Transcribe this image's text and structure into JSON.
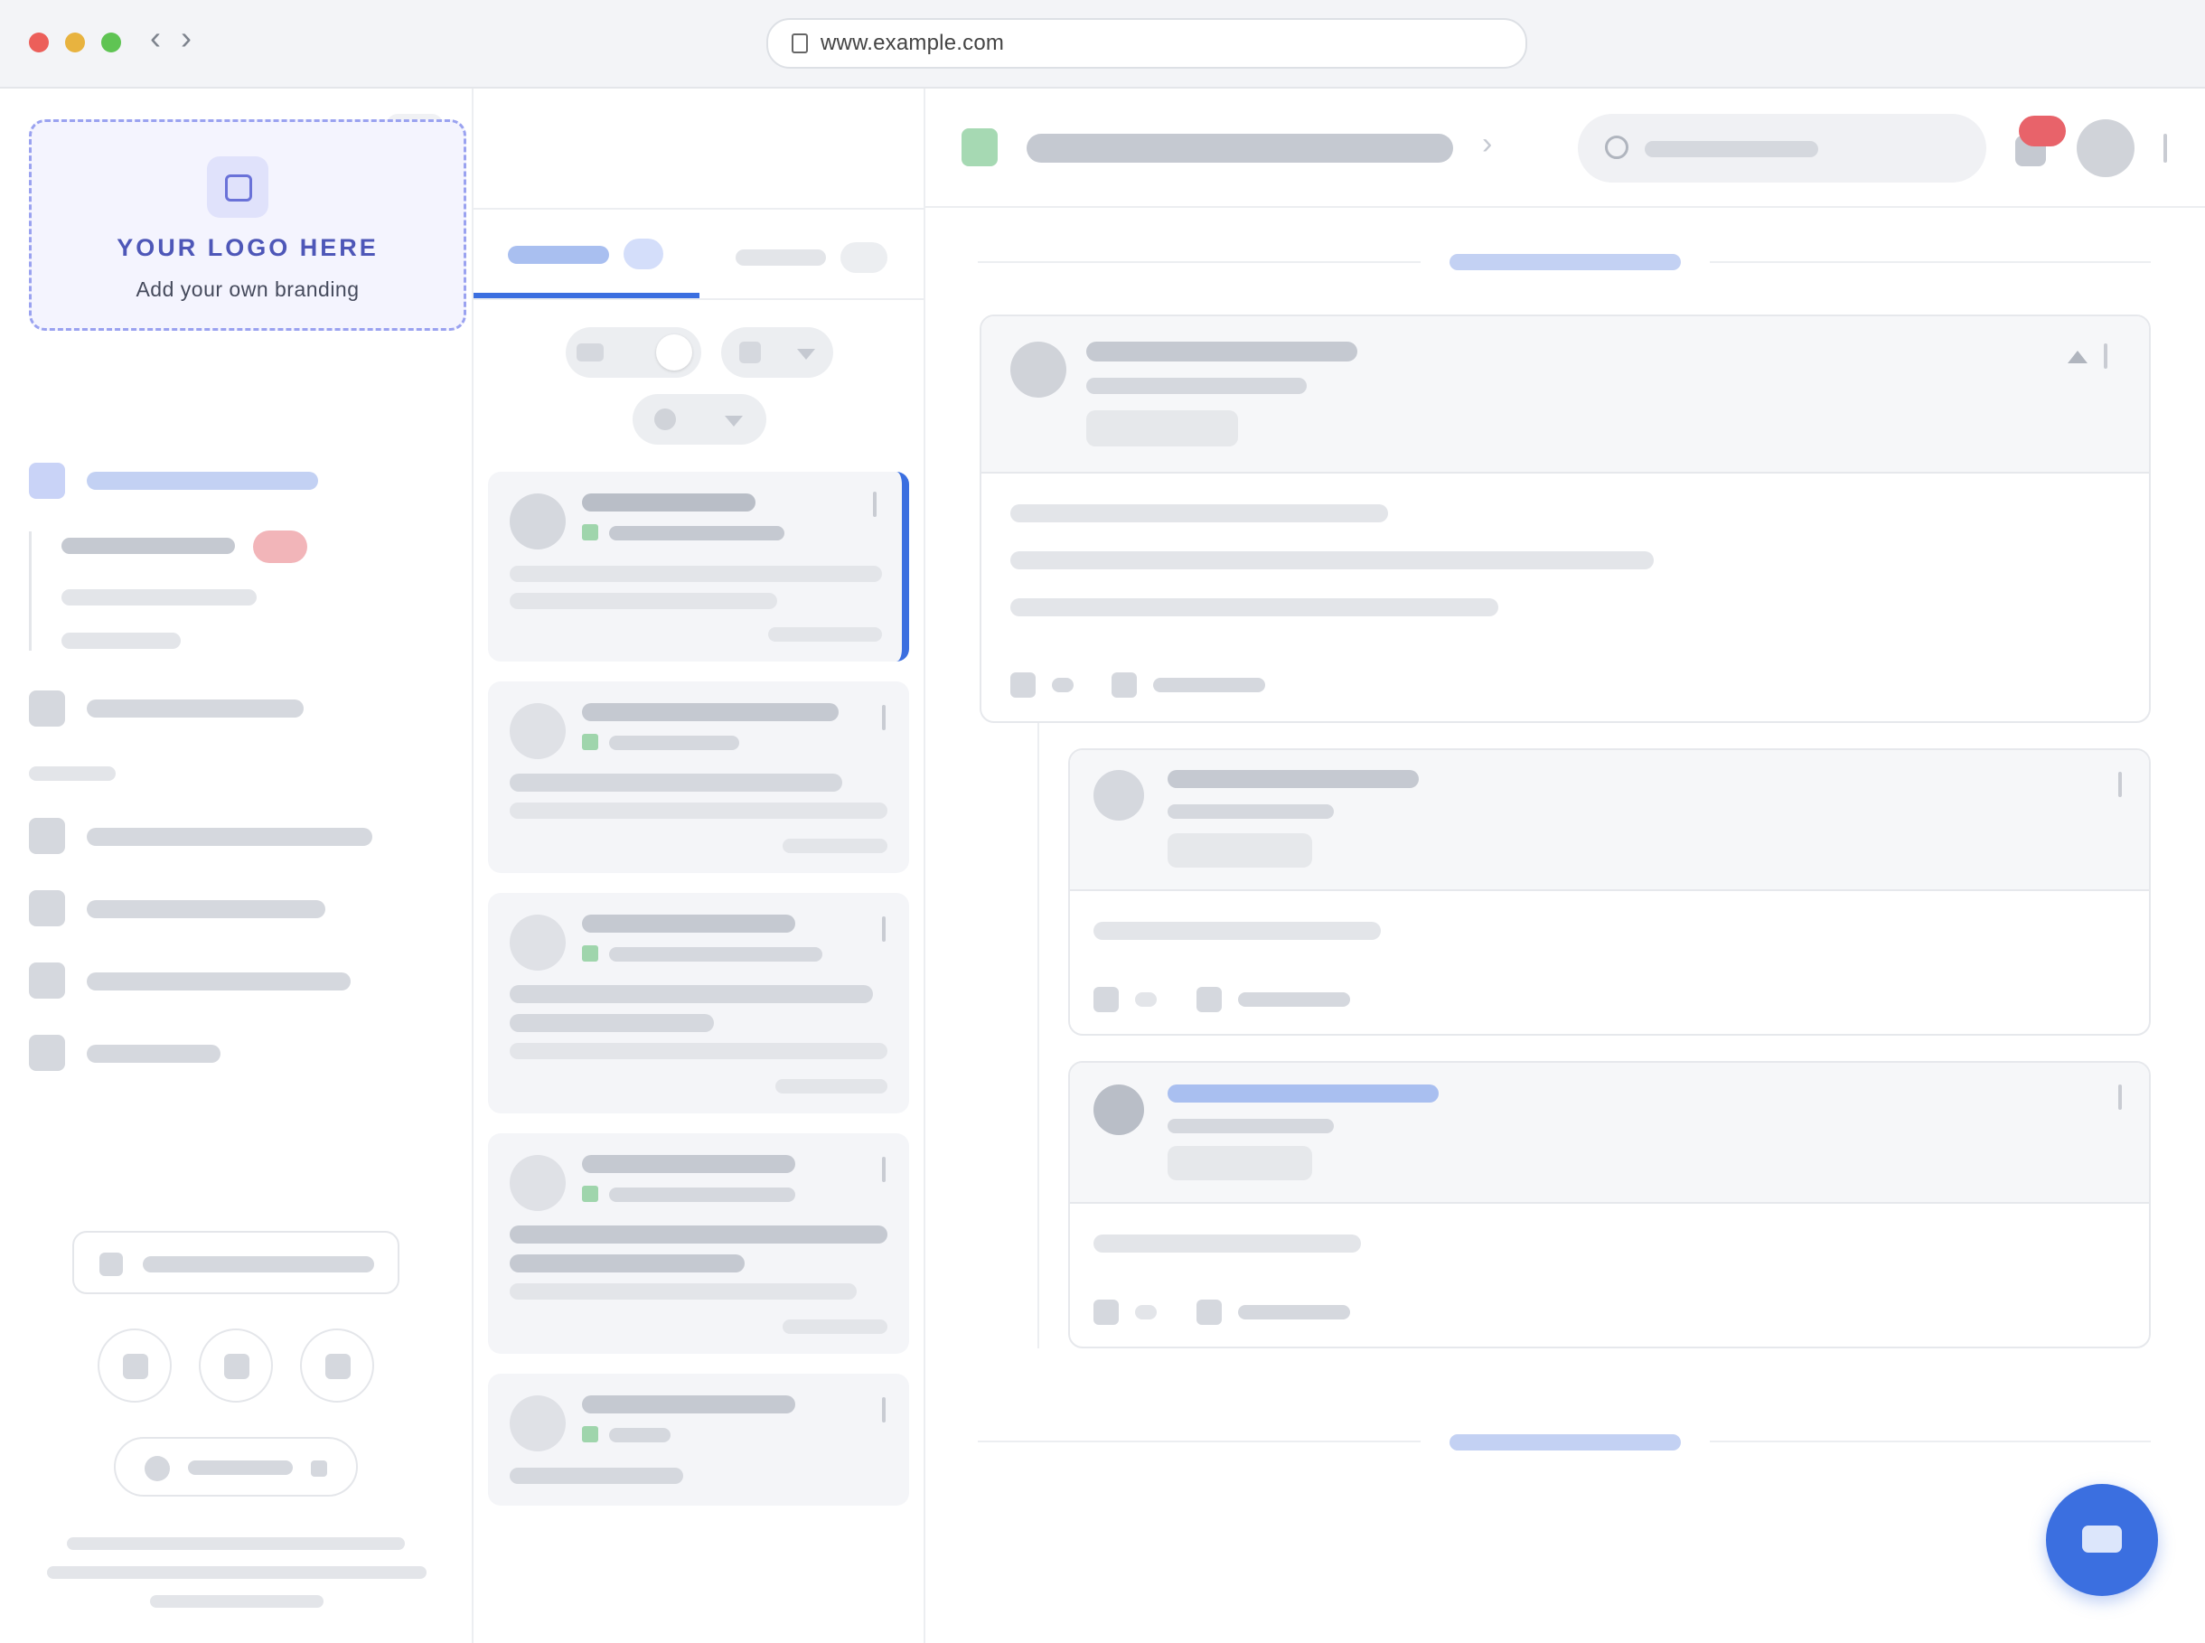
{
  "browser": {
    "url": "www.example.com"
  },
  "sidebar": {
    "logo_title": "YOUR LOGO HERE",
    "logo_subtitle": "Add your own branding"
  },
  "colors": {
    "accent": "#3b6fe0",
    "traffic_close": "#ec5f5a",
    "traffic_min": "#e8b33f",
    "traffic_max": "#5fc453",
    "badge_red": "#e8636a",
    "placeholder_gray": "#d5d8de",
    "logo_purple": "#4e57b8"
  },
  "icons": {
    "back": "chevron-left-icon",
    "forward": "chevron-right-icon",
    "page": "page-icon",
    "fab": "chat-icon"
  }
}
